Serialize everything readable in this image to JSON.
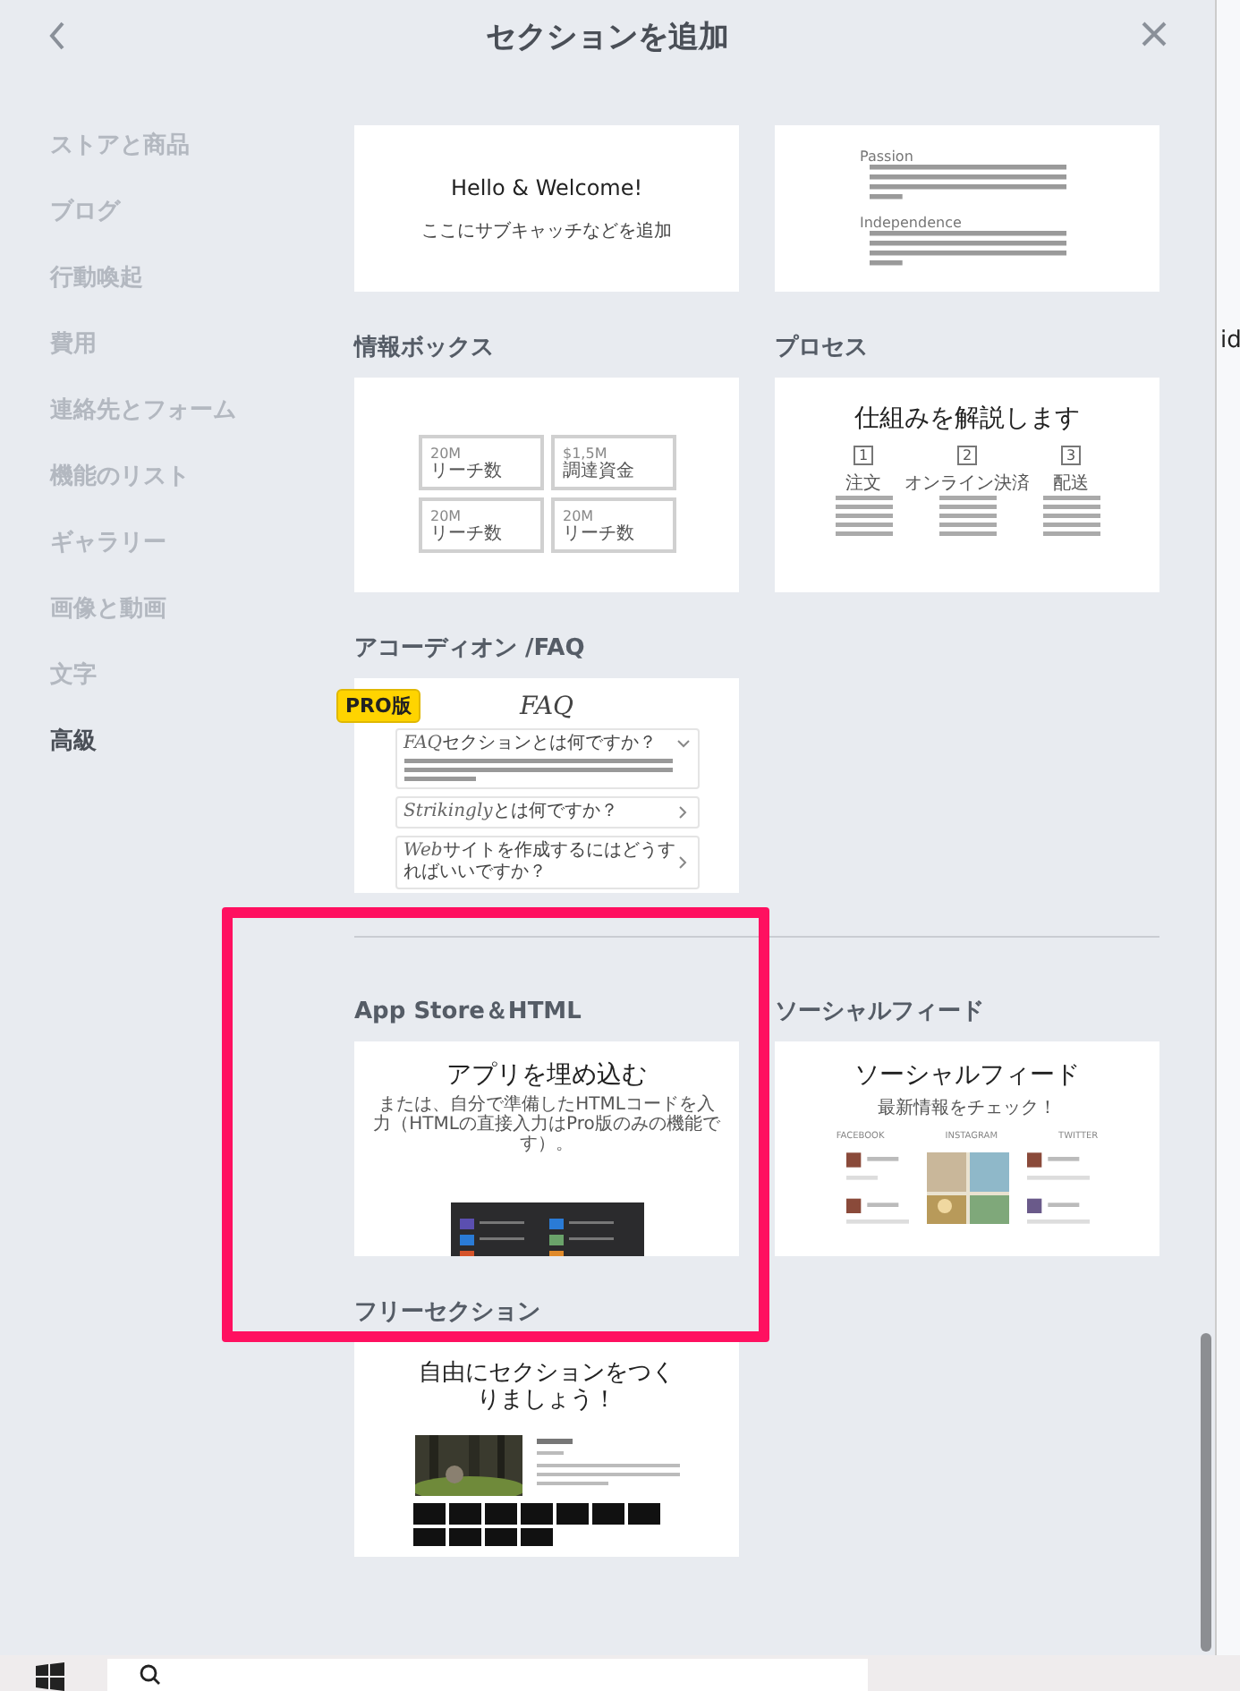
{
  "title": "セクションを追加",
  "sidebar": [
    {
      "label": "ストアと商品",
      "selected": false
    },
    {
      "label": "ブログ",
      "selected": false
    },
    {
      "label": "行動喚起",
      "selected": false
    },
    {
      "label": "費用",
      "selected": false
    },
    {
      "label": "連絡先とフォーム",
      "selected": false
    },
    {
      "label": "機能のリスト",
      "selected": false
    },
    {
      "label": "ギャラリー",
      "selected": false
    },
    {
      "label": "画像と動画",
      "selected": false
    },
    {
      "label": "文字",
      "selected": false
    },
    {
      "label": "高級",
      "selected": true
    }
  ],
  "sections": [
    {
      "kind": "welcome",
      "heading": "Hello & Welcome!",
      "subheading": "ここにサブキャッチなどを追加"
    },
    {
      "kind": "text_blocks",
      "blocks": [
        {
          "heading": "Passion"
        },
        {
          "heading": "Independence"
        }
      ]
    },
    {
      "kind": "info",
      "title": "情報ボックス",
      "boxes": [
        {
          "value": "20M",
          "label": "リーチ数"
        },
        {
          "value": "$1,5M",
          "label": "調達資金"
        },
        {
          "value": "20M",
          "label": "リーチ数"
        },
        {
          "value": "20M",
          "label": "リーチ数"
        }
      ]
    },
    {
      "kind": "process",
      "title": "プロセス",
      "heading": "仕組みを解説します",
      "steps": [
        {
          "number": "1",
          "label": "注文"
        },
        {
          "number": "2",
          "label": "オンライン決済"
        },
        {
          "number": "3",
          "label": "配送"
        }
      ]
    },
    {
      "kind": "faq",
      "title": "アコーディオン /FAQ",
      "badge": "PRO版",
      "heading": "FAQ",
      "items": [
        {
          "script_word": "FAQ",
          "question": "セクションとは何ですか？",
          "expanded": true
        },
        {
          "script_word": "Strikingly",
          "question": "とは何ですか？",
          "expanded": false
        },
        {
          "script_word": "Web",
          "question": "サイトを作成するにはどうすればいいですか？",
          "expanded": false
        }
      ]
    },
    {
      "kind": "divider"
    },
    {
      "kind": "app_store",
      "title": "App Store＆HTML",
      "heading": "アプリを埋め込む",
      "description": "または、自分で準備したHTMLコードを入力（HTMLの直接入力はPro版のみの機能です）。"
    },
    {
      "kind": "social",
      "title": "ソーシャルフィード",
      "heading": "ソーシャルフィード",
      "subheading": "最新情報をチェック！",
      "networks": [
        "FACEBOOK",
        "INSTAGRAM",
        "TWITTER"
      ]
    },
    {
      "kind": "free",
      "title": "フリーセクション",
      "heading": "自由にセクションをつくりましょう！"
    }
  ],
  "background_app": {
    "text": "id"
  }
}
